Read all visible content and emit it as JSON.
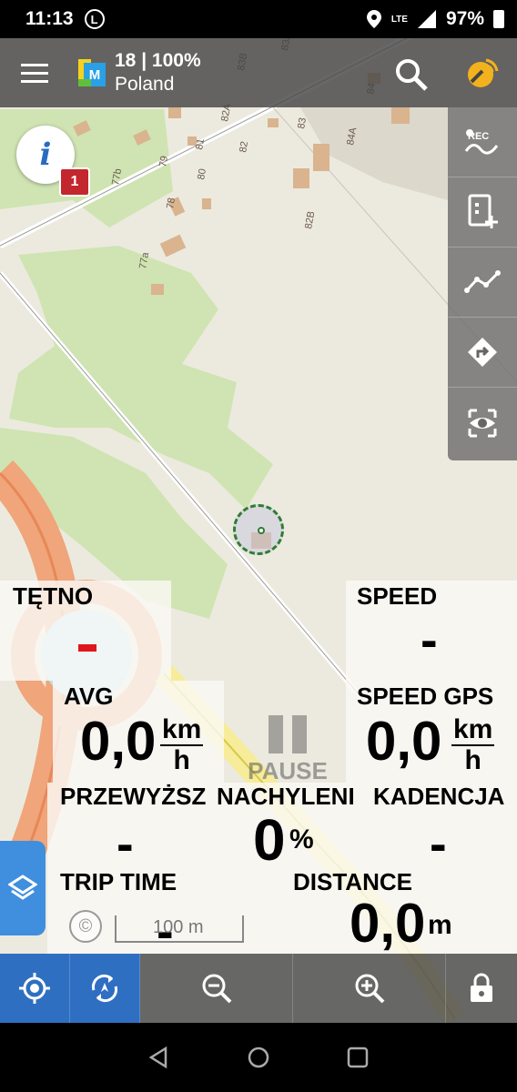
{
  "status_bar": {
    "time": "11:13",
    "app_indicator": "L",
    "network": "LTE",
    "battery": "97%"
  },
  "top_bar": {
    "zoom_info": "18 | 100%",
    "map_name": "Poland",
    "logo_letter": "M"
  },
  "right_panel": {
    "rec_label": "REC",
    "items": [
      "track-record-icon",
      "add-point-icon",
      "route-planner-icon",
      "navigation-icon",
      "map-view-icon"
    ]
  },
  "info_badge": "1",
  "map_labels": [
    "83A",
    "83B",
    "84",
    "84A",
    "82A",
    "82",
    "83",
    "81",
    "80",
    "79",
    "77b",
    "78",
    "77a",
    "82B",
    "85"
  ],
  "dashboard": {
    "heart_rate": {
      "label": "TĘTNO",
      "value": ""
    },
    "speed": {
      "label": "SPEED",
      "value": "-"
    },
    "avg": {
      "label": "AVG",
      "value": "0,0",
      "unit_top": "km",
      "unit_bottom": "h"
    },
    "speed_gps": {
      "label": "SPEED GPS",
      "value": "0,0",
      "unit_top": "km",
      "unit_bottom": "h"
    },
    "elevation": {
      "label": "PRZEWYŻSZ",
      "value": "-"
    },
    "slope": {
      "label": "NACHYLENI",
      "value": "0",
      "unit": "%"
    },
    "cadence": {
      "label": "KADENCJA",
      "value": "-"
    },
    "trip_time": {
      "label": "TRIP TIME",
      "value": "-"
    },
    "distance": {
      "label": "DISTANCE",
      "value": "0,0",
      "unit": "m"
    }
  },
  "pause_label": "PAUSE",
  "scale_label": "100 m",
  "copyright_symbol": "©",
  "colors": {
    "accent_blue": "#2f6fc2",
    "badge_red": "#c4262e",
    "location_green": "#2e7d32"
  }
}
